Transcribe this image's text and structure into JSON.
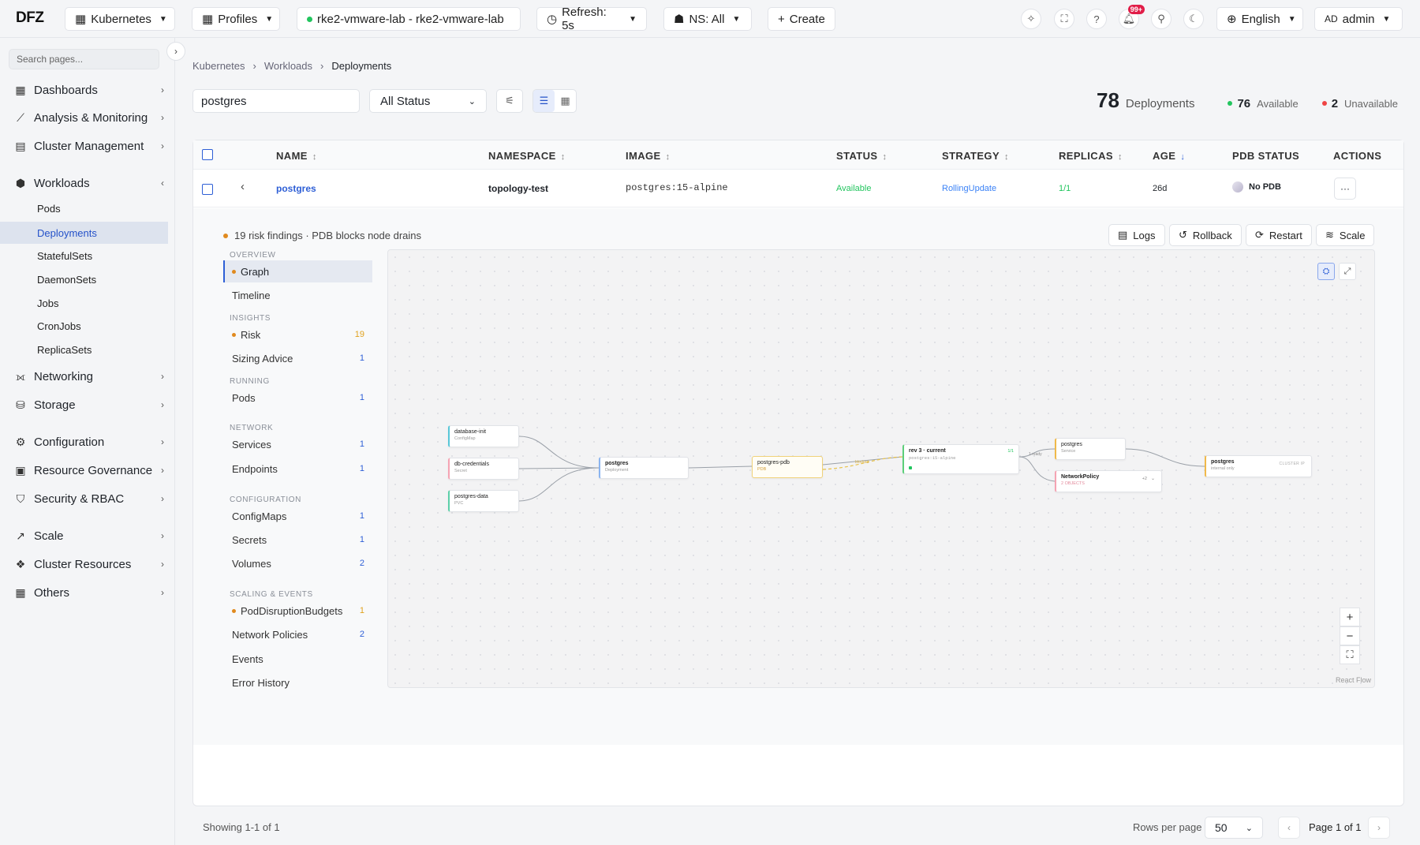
{
  "topbar": {
    "logo": "DFZ",
    "kubernetes": "Kubernetes",
    "profiles": "Profiles",
    "cluster": "rke2-vmware-lab - rke2-vmware-lab",
    "refresh": "Refresh: 5s",
    "namespace": "NS: All",
    "create": "Create",
    "notif_badge": "99+",
    "language": "English",
    "user_initials": "AD",
    "user": "admin"
  },
  "sidebar": {
    "search_placeholder": "Search pages...",
    "groups": {
      "dashboards": "Dashboards",
      "analysis": "Analysis & Monitoring",
      "cluster": "Cluster Management",
      "workloads": "Workloads",
      "networking": "Networking",
      "storage": "Storage",
      "configuration": "Configuration",
      "governance": "Resource Governance",
      "security": "Security & RBAC",
      "scale": "Scale",
      "resources": "Cluster Resources",
      "others": "Others"
    },
    "workload_items": [
      "Pods",
      "Deployments",
      "StatefulSets",
      "DaemonSets",
      "Jobs",
      "CronJobs",
      "ReplicaSets"
    ]
  },
  "breadcrumb": [
    "Kubernetes",
    "Workloads",
    "Deployments"
  ],
  "filters": {
    "search_value": "postgres",
    "status": "All Status"
  },
  "summary": {
    "total": "78",
    "total_label": "Deployments",
    "available": "76",
    "available_label": "Available",
    "unavailable": "2",
    "unavailable_label": "Unavailable"
  },
  "table": {
    "headers": {
      "name": "NAME",
      "namespace": "NAMESPACE",
      "image": "IMAGE",
      "status": "STATUS",
      "strategy": "STRATEGY",
      "replicas": "REPLICAS",
      "age": "AGE",
      "pdb": "PDB STATUS",
      "actions": "ACTIONS"
    },
    "row": {
      "name": "postgres",
      "namespace": "topology-test",
      "image": "postgres:15-alpine",
      "status": "Available",
      "strategy": "RollingUpdate",
      "replicas": "1/1",
      "age": "26d",
      "pdb": "No PDB"
    }
  },
  "detail": {
    "risk_summary": "19 risk findings · PDB blocks node drains",
    "actions": {
      "logs": "Logs",
      "rollback": "Rollback",
      "restart": "Restart",
      "scale": "Scale"
    },
    "sections": {
      "overview": "OVERVIEW",
      "insights": "INSIGHTS",
      "running": "RUNNING",
      "network": "NETWORK",
      "configuration": "CONFIGURATION",
      "scaling": "SCALING & EVENTS"
    },
    "items": {
      "graph": "Graph",
      "timeline": "Timeline",
      "risk": "Risk",
      "risk_count": "19",
      "sizing": "Sizing Advice",
      "sizing_count": "1",
      "pods": "Pods",
      "pods_count": "1",
      "services": "Services",
      "services_count": "1",
      "endpoints": "Endpoints",
      "endpoints_count": "1",
      "configmaps": "ConfigMaps",
      "configmaps_count": "1",
      "secrets": "Secrets",
      "secrets_count": "1",
      "volumes": "Volumes",
      "volumes_count": "2",
      "pdb": "PodDisruptionBudgets",
      "pdb_count": "1",
      "netpol": "Network Policies",
      "netpol_count": "2",
      "events": "Events",
      "errors": "Error History"
    },
    "graph": {
      "nodes": {
        "db_init": "database-init",
        "db_init_kind": "ConfigMap",
        "db_cred": "db-credentials",
        "db_cred_kind": "Secret",
        "pg_data": "postgres-data",
        "pg_data_kind": "PVC",
        "deploy": "postgres",
        "deploy_kind": "Deployment",
        "pdb": "postgres-pdb",
        "pdb_kind": "PDB",
        "rev": "rev 3 · current",
        "rev_image": "postgres:15-alpine",
        "rev_ratio": "1/1",
        "svc": "postgres",
        "svc_kind": "Service",
        "np": "NetworkPolicy",
        "np_sub": "2 OBJECTS",
        "np_more": "+2",
        "cluster_svc": "postgres",
        "cluster_svc_sub": "internal only",
        "cluster_tag": "CLUSTER IP"
      },
      "edge_ready": "1 ready",
      "edge_blocked": "blocked",
      "credit": "React Flow"
    }
  },
  "pagination": {
    "showing": "Showing 1-1 of 1",
    "rows_label": "Rows per page",
    "rows_value": "50",
    "page": "Page 1 of 1"
  },
  "colors": {
    "accent": "#2e5fd6",
    "available": "#22c55e",
    "unavailable": "#ef4444",
    "warning": "#e08a1e"
  }
}
